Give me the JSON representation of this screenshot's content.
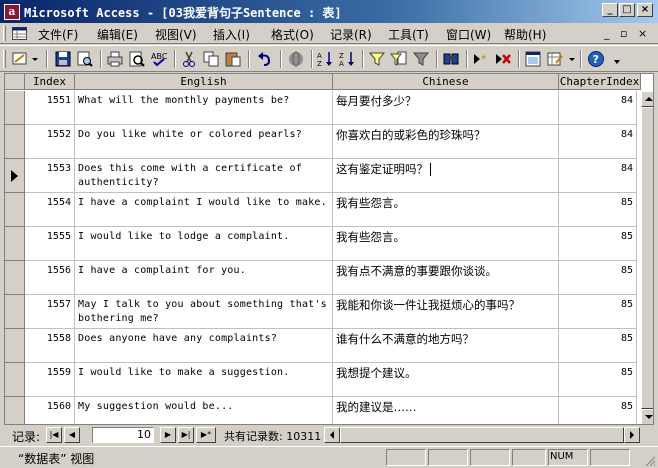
{
  "window": {
    "title": "Microsoft Access - [03我爱背句子Sentence : 表]",
    "app_icon_letter": "a"
  },
  "menu": {
    "items": [
      {
        "label": "文件(F)"
      },
      {
        "label": "编辑(E)"
      },
      {
        "label": "视图(V)"
      },
      {
        "label": "插入(I)"
      },
      {
        "label": "格式(O)"
      },
      {
        "label": "记录(R)"
      },
      {
        "label": "工具(T)"
      },
      {
        "label": "窗口(W)"
      },
      {
        "label": "帮助(H)"
      }
    ]
  },
  "toolbar": {
    "buttons": [
      "view-icon",
      "save-icon",
      "search-file-icon",
      "print-icon",
      "print-preview-icon",
      "spelling-icon",
      "cut-icon",
      "copy-icon",
      "paste-icon",
      "undo-icon",
      "hyperlink-icon",
      "sort-ascending-icon",
      "sort-descending-icon",
      "filter-by-selection-icon",
      "filter-by-form-icon",
      "apply-filter-icon",
      "find-icon",
      "new-record-icon",
      "delete-record-icon",
      "database-window-icon",
      "new-object-icon",
      "help-icon"
    ]
  },
  "table": {
    "columns": [
      "Index",
      "English",
      "Chinese",
      "ChapterIndex"
    ],
    "rows": [
      {
        "index": "1551",
        "english": "What will the monthly payments be?",
        "chinese": "每月要付多少？",
        "chapter": "84"
      },
      {
        "index": "1552",
        "english": "Do you like white or colored pearls?",
        "chinese": "你喜欢白的或彩色的珍珠吗？",
        "chapter": "84"
      },
      {
        "index": "1553",
        "english": "Does this come with a certificate of authenticity?",
        "chinese": "这有鉴定证明吗？",
        "chapter": "84",
        "current": true
      },
      {
        "index": "1554",
        "english": "I have a complaint I would like to make.",
        "chinese": "我有些怨言。",
        "chapter": "85"
      },
      {
        "index": "1555",
        "english": "I would like to lodge a complaint.",
        "chinese": "我有些怨言。",
        "chapter": "85"
      },
      {
        "index": "1556",
        "english": "I have a complaint for you.",
        "chinese": "我有点不满意的事要跟你谈谈。",
        "chapter": "85"
      },
      {
        "index": "1557",
        "english": "May I talk to you about something that's bothering me?",
        "chinese": "我能和你谈一件让我挺烦心的事吗？",
        "chapter": "85"
      },
      {
        "index": "1558",
        "english": "Does anyone have any complaints?",
        "chinese": "谁有什么不满意的地方吗？",
        "chapter": "85"
      },
      {
        "index": "1559",
        "english": "I would like to make a suggestion.",
        "chinese": "我想提个建议。",
        "chapter": "85"
      },
      {
        "index": "1560",
        "english": "My suggestion would be...",
        "chinese": "我的建议是……",
        "chapter": "85"
      }
    ]
  },
  "navigator": {
    "label": "记录:",
    "current": "10",
    "total_text": "共有记录数: 10311"
  },
  "status": {
    "text": "“数据表” 视图",
    "num": "NUM"
  }
}
